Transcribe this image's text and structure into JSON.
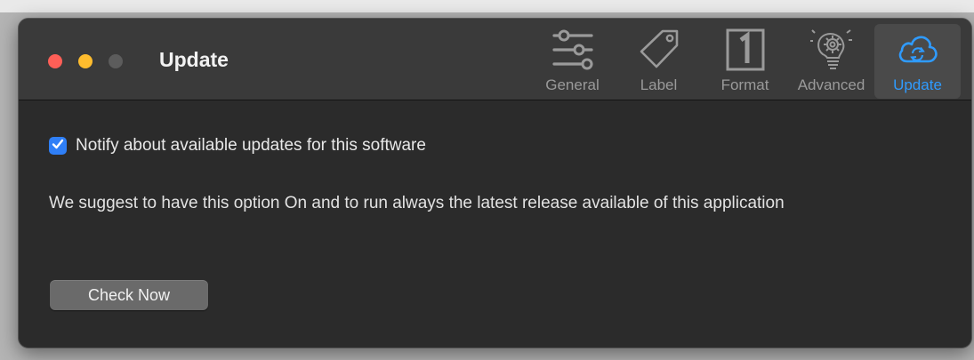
{
  "window": {
    "title": "Update"
  },
  "toolbar": {
    "tabs": [
      {
        "label": "General",
        "icon": "sliders-icon",
        "selected": false
      },
      {
        "label": "Label",
        "icon": "tag-icon",
        "selected": false
      },
      {
        "label": "Format",
        "icon": "number-one-box-icon",
        "selected": false
      },
      {
        "label": "Advanced",
        "icon": "gear-bulb-icon",
        "selected": false
      },
      {
        "label": "Update",
        "icon": "cloud-sync-icon",
        "selected": true
      }
    ],
    "selected_color": "#2f9bff"
  },
  "settings": {
    "notify_label": "Notify about available updates for this software",
    "notify_checked": true,
    "description": "We suggest to have this option On and to run always the latest release available of this application",
    "check_now_label": "Check Now"
  },
  "colors": {
    "close": "#fe5f57",
    "minimize": "#febc2e",
    "zoom_disabled": "#5c5c5c",
    "checkbox": "#2f7ff7"
  }
}
